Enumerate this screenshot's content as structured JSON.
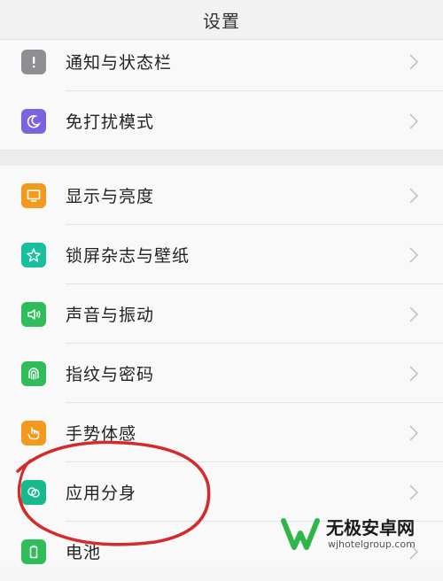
{
  "header": {
    "title": "设置"
  },
  "groups": [
    {
      "items": [
        {
          "label": "通知与状态栏",
          "icon": "exclamation-icon",
          "color": "#8e8e93"
        },
        {
          "label": "免打扰模式",
          "icon": "moon-icon",
          "color": "#7b63e0"
        }
      ]
    },
    {
      "items": [
        {
          "label": "显示与亮度",
          "icon": "monitor-icon",
          "color": "#f39a1e"
        },
        {
          "label": "锁屏杂志与壁纸",
          "icon": "flower-icon",
          "color": "#18c19b"
        },
        {
          "label": "声音与振动",
          "icon": "speaker-icon",
          "color": "#2ebd59"
        },
        {
          "label": "指纹与密码",
          "icon": "fingerprint-icon",
          "color": "#2ebd59"
        },
        {
          "label": "手势体感",
          "icon": "hand-gesture-icon",
          "color": "#f39a1e"
        },
        {
          "label": "应用分身",
          "icon": "app-clone-icon",
          "color": "#18b98e"
        },
        {
          "label": "电池",
          "icon": "battery-icon",
          "color": "#2ebd59"
        }
      ]
    }
  ],
  "watermark": {
    "name": "无极安卓网",
    "url": "wjhotelgroup.com",
    "color": "#2fb54a"
  },
  "annotation": {
    "color": "#d42a2a"
  }
}
